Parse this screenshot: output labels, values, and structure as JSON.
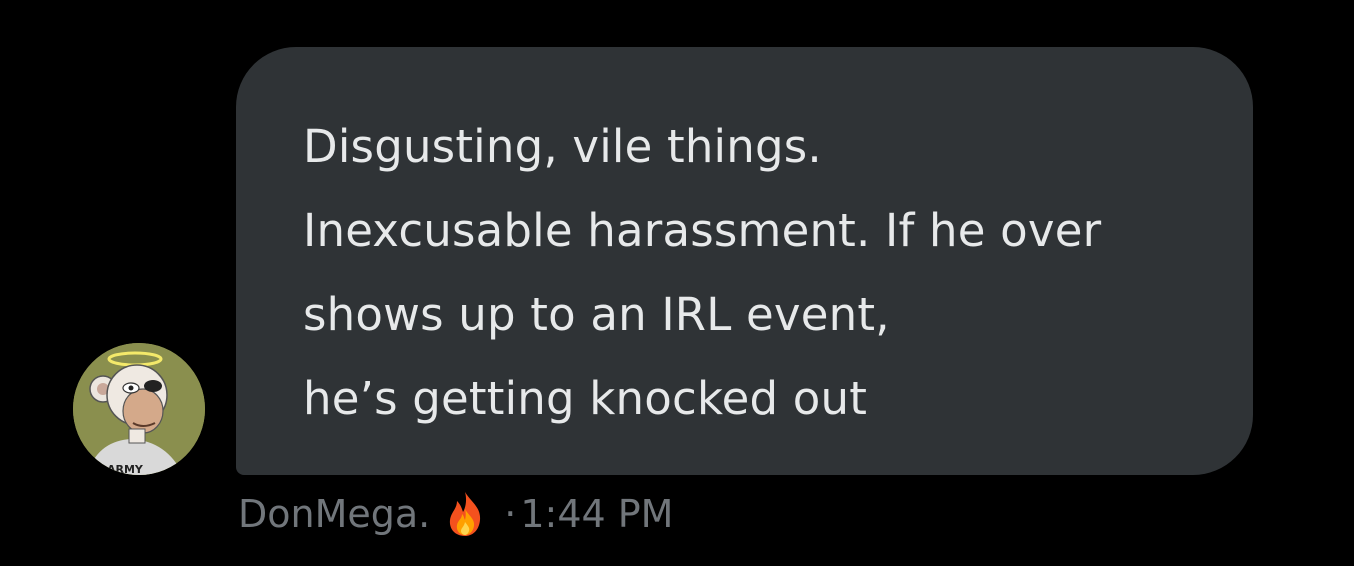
{
  "message": {
    "text": "Disgusting, vile things.\nInexcusable harassment. If he over shows up to an IRL event,\nhe’s getting knocked out",
    "sender_name": "DonMega.",
    "sender_emoji": "fire-icon",
    "separator": "·",
    "timestamp": "1:44 PM",
    "avatar_badge_text": "ARMY"
  },
  "colors": {
    "background": "#000000",
    "bubble": "#2f3336",
    "message_text": "#e7e9ea",
    "meta_text": "#71767b"
  }
}
